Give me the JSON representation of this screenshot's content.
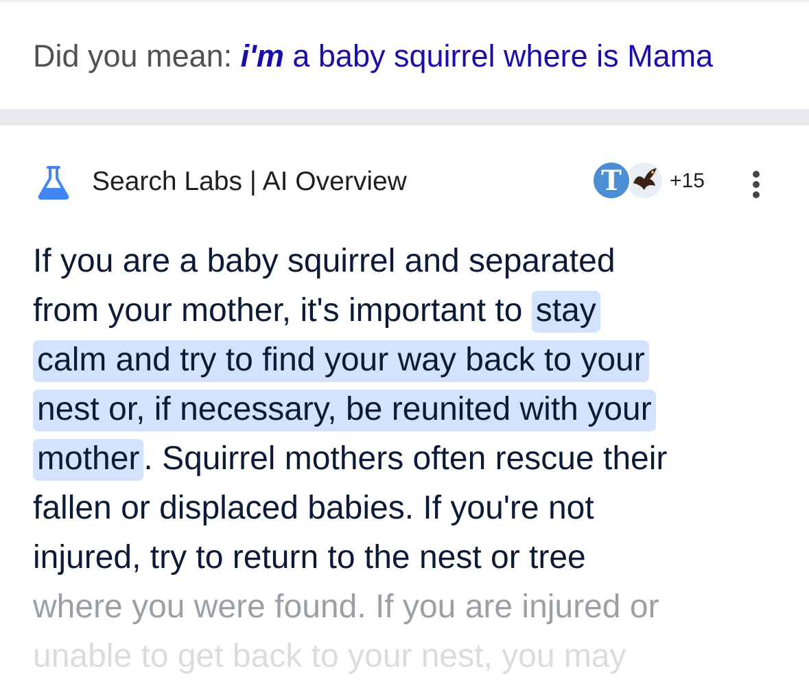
{
  "spelling": {
    "prefix": "Did you mean: ",
    "corrected_bold": "i'm",
    "corrected_rest": " a baby squirrel where is Mama"
  },
  "overview": {
    "header_title": "Search Labs | AI Overview",
    "avatar_letter": "T",
    "more_count": "+15",
    "icons": {
      "flask": "flask-icon",
      "bird": "bird-avatar-icon",
      "more": "more-vert-icon"
    },
    "colors": {
      "link": "#1a0dab",
      "flask": "#4285f4",
      "highlight": "#d3e3fd"
    },
    "text": {
      "line1": "If you are a baby squirrel and separated",
      "line2_pre": "from your mother, it's important to ",
      "line2_hl": "stay",
      "line3_hl": "calm and try to find your way back to your",
      "line4_hl": "nest or, if necessary, be reunited with your",
      "line5_hl": "mother",
      "line5_post": ". Squirrel mothers often rescue their",
      "line6": "fallen or displaced babies. If you're not",
      "line7": "injured, try to return to the nest or tree",
      "line8": "where you were found. If you are injured or",
      "line9": "unable to get back to your nest, you may"
    }
  }
}
